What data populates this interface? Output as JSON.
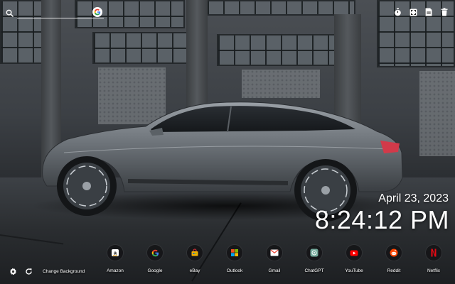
{
  "search": {
    "placeholder": "",
    "engine_icon": "google-icon"
  },
  "toolbar_right": [
    {
      "icon": "timer-icon"
    },
    {
      "icon": "fullscreen-icon"
    },
    {
      "icon": "save-icon"
    },
    {
      "icon": "trash-icon"
    }
  ],
  "clock": {
    "date": "April 23, 2023",
    "time": "8:24:12 PM"
  },
  "shortcuts": [
    {
      "label": "Amazon",
      "icon": "amazon-icon",
      "color": "#ffffff"
    },
    {
      "label": "Google",
      "icon": "google-icon",
      "color": "#4285f4"
    },
    {
      "label": "eBay",
      "icon": "ebay-icon",
      "color": "#e53238"
    },
    {
      "label": "Outlook",
      "icon": "outlook-icon",
      "color": "#0078d4"
    },
    {
      "label": "Gmail",
      "icon": "gmail-icon",
      "color": "#ea4335"
    },
    {
      "label": "ChatGPT",
      "icon": "chatgpt-icon",
      "color": "#74aa9c"
    },
    {
      "label": "YouTube",
      "icon": "youtube-icon",
      "color": "#ff0000"
    },
    {
      "label": "Reddit",
      "icon": "reddit-icon",
      "color": "#ff4500"
    },
    {
      "label": "Netflix",
      "icon": "netflix-icon",
      "color": "#e50914"
    }
  ],
  "bottom_left": {
    "change_background": "Change Background"
  }
}
